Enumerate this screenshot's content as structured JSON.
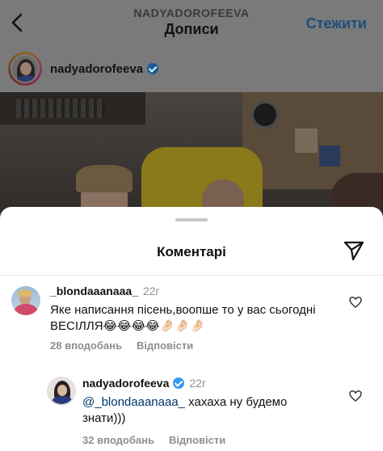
{
  "header": {
    "account": "NADYADOROFEEVA",
    "title": "Дописи",
    "follow_label": "Стежити"
  },
  "post": {
    "username": "nadyadorofeeva",
    "verified": true
  },
  "comments_sheet": {
    "title": "Коментарі",
    "comments": [
      {
        "username": "_blondaaanaaa_",
        "time": "22г",
        "text": "Яке написання пісень,воопше то у вас сьогодні ВЕСІЛЛЯ😂😂😂😂🤌🏻🤌🏻🤌🏻",
        "likes": "28 вподобань",
        "reply_label": "Відповісти"
      },
      {
        "username": "nadyadorofeeva",
        "time": "22г",
        "verified": true,
        "mention": "@_blondaaanaaa_",
        "text": " хахаха ну будемо знати)))",
        "likes": "32 вподобань",
        "reply_label": "Відповісти"
      }
    ]
  },
  "colors": {
    "follow": "#1c4e7c",
    "verified": "#3897f0",
    "mention": "#00376b",
    "meta": "#8e8e8e"
  },
  "icons": [
    "back-arrow-icon",
    "verified-badge-icon",
    "share-direct-icon",
    "heart-outline-icon"
  ]
}
